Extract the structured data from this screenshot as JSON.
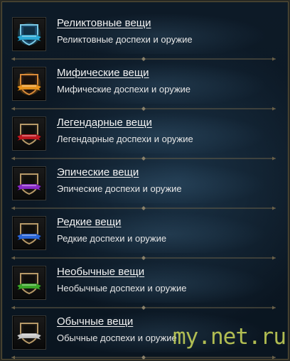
{
  "items": [
    {
      "title": "Реликтовные вещи",
      "subtitle": "Реликтовные доспехи и оружие",
      "ribbon_color": "#2aa9d6",
      "shield_fill": "#1a4a6a",
      "shield_border": "#7ccbe8",
      "icon": "shield-relic-icon"
    },
    {
      "title": "Мифические вещи",
      "subtitle": "Мифические доспехи и оружие",
      "ribbon_color": "#e8921c",
      "shield_fill": "#2a1a10",
      "shield_border": "#d98a38",
      "icon": "shield-mythic-icon"
    },
    {
      "title": "Легендарные вещи",
      "subtitle": "Легендарные доспехи и оружие",
      "ribbon_color": "#c01820",
      "shield_fill": "#1a1612",
      "shield_border": "#b89a68",
      "icon": "shield-legendary-icon"
    },
    {
      "title": "Эпические вещи",
      "subtitle": "Эпические доспехи и оружие",
      "ribbon_color": "#8a2ac8",
      "shield_fill": "#1a1612",
      "shield_border": "#b89a68",
      "icon": "shield-epic-icon"
    },
    {
      "title": "Редкие вещи",
      "subtitle": "Редкие доспехи и оружие",
      "ribbon_color": "#2a66d8",
      "shield_fill": "#1a1612",
      "shield_border": "#b89a68",
      "icon": "shield-rare-icon"
    },
    {
      "title": "Необычные вещи",
      "subtitle": "Необычные доспехи и оружие",
      "ribbon_color": "#3aa828",
      "shield_fill": "#1a1612",
      "shield_border": "#b89a68",
      "icon": "shield-uncommon-icon"
    },
    {
      "title": "Обычные вещи",
      "subtitle": "Обычные доспехи и оружие",
      "ribbon_color": "#c8c8c8",
      "shield_fill": "#1a1612",
      "shield_border": "#b89a68",
      "icon": "shield-common-icon"
    }
  ],
  "divider_color": "#6a6048",
  "watermark": "my.net.ru"
}
